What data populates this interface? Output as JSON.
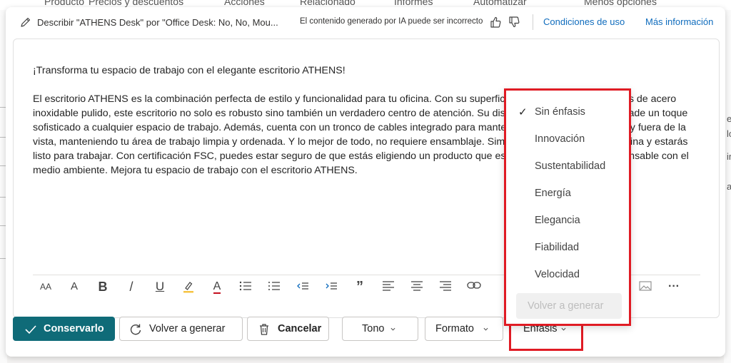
{
  "background": {
    "nav_items": [
      "Producto",
      "Precios y descuentos",
      "Acciones",
      "Relacionado",
      "Informes",
      "Automatizar",
      "Menos opciones"
    ],
    "right_fragments": [
      "e",
      "lo",
      "ir",
      "a"
    ]
  },
  "header": {
    "title": "Describir \"ATHENS Desk\" por \"Office Desk: No, No, Mou...",
    "disclaimer": "El contenido generado por IA puede ser incorrecto",
    "terms_link": "Condiciones de uso",
    "more_info_link": "Más información"
  },
  "editor": {
    "paragraph1": "¡Transforma tu espacio de trabajo con el elegante escritorio ATHENS!",
    "paragraph2": "El escritorio ATHENS es la combinación perfecta de estilo y funcionalidad para tu oficina. Con su superficie de vidrio templado y patas de acero inoxidable pulido, este escritorio no solo es robusto sino también un verdadero centro de atención. Su diseño moderno y elegante añade un toque sofisticado a cualquier espacio de trabajo. Además, cuenta con un tronco de cables integrado para mantener tus cables organizados y fuera de la vista, manteniendo tu área de trabajo limpia y ordenada. Y lo mejor de todo, no requiere ensamblaje. Simplemente colócalo en tu oficina y estarás listo para trabajar. Con certificación FSC, puedes estar seguro de que estás eligiendo un producto que es tanto hermoso como responsable con el medio ambiente. Mejora tu espacio de trabajo con el escritorio ATHENS."
  },
  "toolbar": {
    "font_size_glyph": "AA",
    "font_style_glyph": "A",
    "bold_glyph": "B",
    "italic_glyph": "/",
    "underline_glyph": "U",
    "font_color_glyph": "A",
    "quote_glyph": "”",
    "more_glyph": "···"
  },
  "actions": {
    "keep": "Conservarlo",
    "regenerate": "Volver a generar",
    "cancel": "Cancelar",
    "tone": "Tono",
    "format": "Formato",
    "emphasis": "Énfasis"
  },
  "emphasis_menu": {
    "items": [
      "Sin énfasis",
      "Innovación",
      "Sustentabilidad",
      "Energía",
      "Elegancia",
      "Fiabilidad",
      "Velocidad"
    ],
    "selected_check": "✓",
    "regenerate_disabled": "Volver a generar"
  },
  "colors": {
    "primary": "#0f6b78",
    "link": "#0f6cbd",
    "highlight": "#e01b24"
  }
}
